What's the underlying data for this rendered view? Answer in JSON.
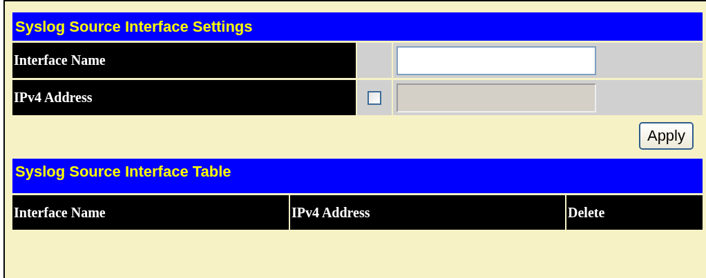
{
  "settings": {
    "title": "Syslog Source Interface Settings",
    "rows": [
      {
        "label": "Interface Name",
        "kind": "text",
        "disabled": false
      },
      {
        "label": "IPv4 Address",
        "kind": "checkbox_text",
        "checked": false,
        "disabled": true
      }
    ],
    "apply_button": "Apply"
  },
  "table": {
    "title": "Syslog Source Interface Table",
    "columns": [
      "Interface Name",
      "IPv4 Address",
      "Delete"
    ]
  }
}
